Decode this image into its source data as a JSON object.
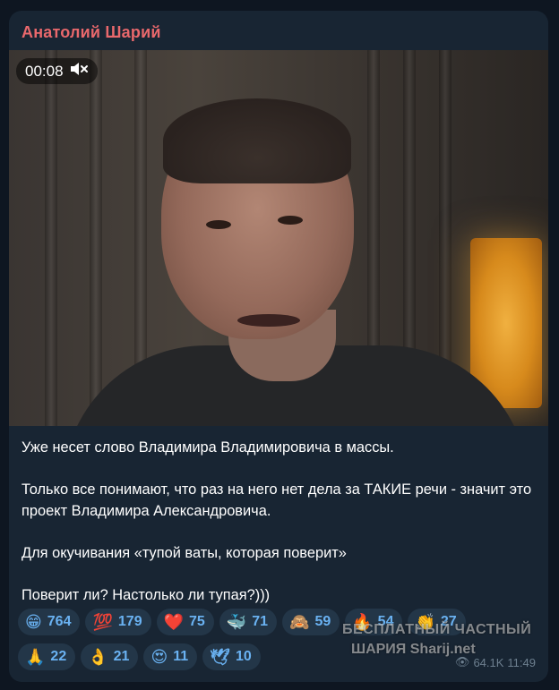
{
  "post": {
    "author": "Анатолий Шарий",
    "video": {
      "timer": "00:08",
      "muted": true
    },
    "text": [
      "Уже несет слово Владимира Владимировича в массы.",
      "Только все понимают, что раз на него нет дела за ТАКИЕ речи - значит это проект Владимира Александровича.",
      "Для окучивания «тупой ваты, которая поверит»",
      "Поверит ли? Настолько ли тупая?)))"
    ],
    "reactions": [
      {
        "emoji": "😁",
        "count": "764"
      },
      {
        "emoji": "💯",
        "count": "179"
      },
      {
        "emoji": "❤️",
        "count": "75"
      },
      {
        "emoji": "🐳",
        "count": "71"
      },
      {
        "emoji": "🙈",
        "count": "59"
      },
      {
        "emoji": "🔥",
        "count": "54"
      },
      {
        "emoji": "👏",
        "count": "27"
      },
      {
        "emoji": "🙏",
        "count": "22"
      },
      {
        "emoji": "👌",
        "count": "21"
      },
      {
        "emoji": "😍",
        "count": "11"
      },
      {
        "emoji": "🕊",
        "count": "10"
      }
    ],
    "meta": {
      "views": "64.1K",
      "time": "11:49"
    }
  },
  "watermark": {
    "line1": "БЕСПЛАТНЫЙ ЧАСТНЫЙ",
    "line2": "ШАРИЯ Sharij.net"
  },
  "colors": {
    "background": "#0e1621",
    "card": "#182533",
    "author": "#e9686c",
    "reaction_bg": "#233648",
    "reaction_text": "#6ab2f2"
  }
}
